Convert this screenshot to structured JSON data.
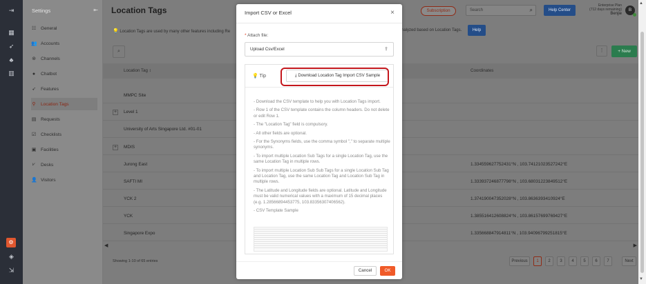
{
  "rail": {
    "icons": [
      "app-switch-icon",
      "dashboard-icon",
      "rocket-icon",
      "org-chart-icon",
      "analytics-icon",
      "settings-icon",
      "cube-icon",
      "logout-icon"
    ]
  },
  "sidebar": {
    "title": "Settings",
    "collapse_icon": "collapse-icon",
    "items": [
      {
        "label": "General",
        "icon": "sliders-icon"
      },
      {
        "label": "Accounts",
        "icon": "users-icon"
      },
      {
        "label": "Channels",
        "icon": "channels-icon"
      },
      {
        "label": "Chatbot",
        "icon": "chat-icon"
      },
      {
        "label": "Features",
        "icon": "rocket-icon"
      },
      {
        "label": "Location Tags",
        "icon": "location-pin-icon",
        "active": true
      },
      {
        "label": "Requests",
        "icon": "inbox-icon"
      },
      {
        "label": "Checklists",
        "icon": "checklist-icon"
      },
      {
        "label": "Facilities",
        "icon": "calendar-icon"
      },
      {
        "label": "Desks",
        "icon": "desk-icon"
      },
      {
        "label": "Visitors",
        "icon": "visitor-icon"
      }
    ]
  },
  "header": {
    "title": "Location Tags",
    "subscription": "Subscription",
    "search_placeholder": "Search",
    "help_center": "Help Center",
    "plan_line1": "Enterprise Plan",
    "plan_line2": "(712 days remaining)",
    "user_name": "Benjie",
    "avatar_initial": "B"
  },
  "info": {
    "text_left": "Location Tags are used by many other features including Re",
    "text_right": "nalyzed based on Location Tags.",
    "help": "Help"
  },
  "toolbar": {
    "filter_icon": "search-icon",
    "more": "⋮",
    "new_button": "+ New"
  },
  "table": {
    "col_location_tag": "Location Tag ↕",
    "col_coordinates": "Coordinates",
    "rows": [
      {
        "name": "MMPC Site",
        "coords": "",
        "expandable": false
      },
      {
        "name": "Level 1",
        "coords": "",
        "expandable": true
      },
      {
        "name": "University of Arts Singapore Ltd. #01-01",
        "coords": "",
        "expandable": false
      },
      {
        "name": "MDIS",
        "coords": "",
        "expandable": true
      },
      {
        "name": "Jurong East",
        "coords": "1.334559627752431°N , 103.74121023527242°E",
        "expandable": false
      },
      {
        "name": "SAFTI MI",
        "coords": "1.333937246877798°N , 103.68031223849512°E",
        "expandable": false
      },
      {
        "name": "YCK 2",
        "coords": "1.374190047352028°N , 103.8636393410924°E",
        "expandable": false
      },
      {
        "name": "YCK",
        "coords": "1.385516412608824°N , 103.86157699769427°E",
        "expandable": false
      },
      {
        "name": "Singapore Expo",
        "coords": "1.335668847914811°N , 103.94096799251815°E",
        "expandable": false
      }
    ]
  },
  "footer": {
    "showing": "Showing 1-10 of 65 entries"
  },
  "pagination": {
    "prev": "Previous",
    "pages": [
      "1",
      "2",
      "3",
      "4",
      "5",
      "6",
      "7"
    ],
    "next": "Next",
    "current": "1"
  },
  "modal": {
    "title": "Import CSV or Excel",
    "close": "×",
    "attach_label": "Attach file:",
    "required_mark": "*",
    "upload_text": "Upload Csv/Excel",
    "upload_icon": "upload-icon",
    "tip_label": "Tip",
    "download_button": "Download Location Tag Import CSV Sample",
    "tips": [
      "- Download the CSV template to help you with Location Tags import.",
      "- Row 1 of the CSV template contains the column headers. Do not delete or edit Row 1.",
      "- The \"Location Tag\" field is compulsory.",
      "- All other fields are optional.",
      "- For the Synonyms fields, use the comma symbol \",\" to separate multiple synonyms.",
      "- To import multiple Location Sub Tags for a single Location Tag, use the same Location Tag in multiple rows.",
      "- To import multiple Location Sub Sub Tags for a single Location Sub Tag and Location Tag, use the same Location Tag and Location Sub Tag in multiple rows.",
      "- The Latitude and Longitude fields are optional. Latitude and Longitude must be valid numerical values with a maximum of 15 decimal places (e.g. 1.28566894453775, 103.83356307406562).",
      "- CSV Template Sample"
    ],
    "cancel": "Cancel",
    "ok": "OK"
  }
}
